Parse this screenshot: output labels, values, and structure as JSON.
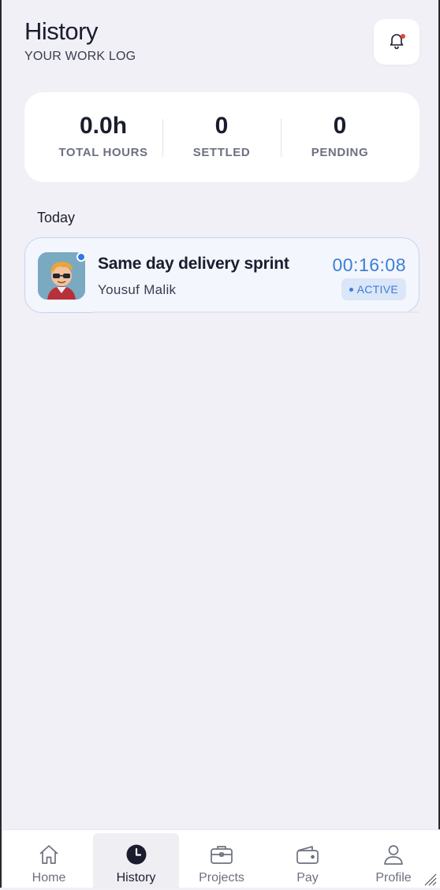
{
  "header": {
    "title": "History",
    "subtitle": "YOUR WORK LOG"
  },
  "icons": {
    "notification": "bell-icon",
    "notification_badge_color": "#e4453a"
  },
  "stats": [
    {
      "value": "0.0h",
      "label": "TOTAL HOURS"
    },
    {
      "value": "0",
      "label": "SETTLED"
    },
    {
      "value": "0",
      "label": "PENDING"
    }
  ],
  "section": {
    "label": "Today"
  },
  "entries": [
    {
      "title": "Same day delivery sprint",
      "person": "Yousuf Malik",
      "time": "00:16:08",
      "status": "ACTIVE",
      "status_color": "#3a7fd6"
    }
  ],
  "tabs": [
    {
      "label": "Home",
      "icon": "home-icon",
      "active": false
    },
    {
      "label": "History",
      "icon": "clock-icon",
      "active": true
    },
    {
      "label": "Projects",
      "icon": "briefcase-icon",
      "active": false
    },
    {
      "label": "Pay",
      "icon": "wallet-icon",
      "active": false
    },
    {
      "label": "Profile",
      "icon": "user-icon",
      "active": false
    }
  ],
  "colors": {
    "background": "#f0f0f6",
    "accent": "#3a7fd6",
    "text_primary": "#1b1d2e"
  }
}
